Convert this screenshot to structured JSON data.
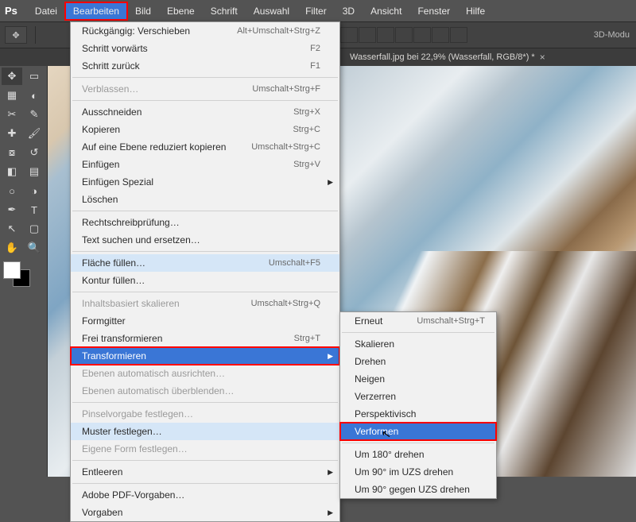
{
  "menubar": {
    "logo": "Ps",
    "items": [
      "Datei",
      "Bearbeiten",
      "Bild",
      "Ebene",
      "Schrift",
      "Auswahl",
      "Filter",
      "3D",
      "Ansicht",
      "Fenster",
      "Hilfe"
    ],
    "active_index": 1
  },
  "optionbar": {
    "mode_label": "3D-Modu"
  },
  "document_tab": {
    "title": "Wasserfall.jpg bei 22,9% (Wasserfall, RGB/8*) *",
    "close": "×"
  },
  "edit_menu": [
    {
      "label": "Rückgängig: Verschieben",
      "shortcut": "Alt+Umschalt+Strg+Z"
    },
    {
      "label": "Schritt vorwärts",
      "shortcut": "F2"
    },
    {
      "label": "Schritt zurück",
      "shortcut": "F1"
    },
    {
      "sep": true
    },
    {
      "label": "Verblassen…",
      "shortcut": "Umschalt+Strg+F",
      "disabled": true
    },
    {
      "sep": true
    },
    {
      "label": "Ausschneiden",
      "shortcut": "Strg+X"
    },
    {
      "label": "Kopieren",
      "shortcut": "Strg+C"
    },
    {
      "label": "Auf eine Ebene reduziert kopieren",
      "shortcut": "Umschalt+Strg+C"
    },
    {
      "label": "Einfügen",
      "shortcut": "Strg+V"
    },
    {
      "label": "Einfügen Spezial",
      "submenu": true
    },
    {
      "label": "Löschen"
    },
    {
      "sep": true
    },
    {
      "label": "Rechtschreibprüfung…"
    },
    {
      "label": "Text suchen und ersetzen…"
    },
    {
      "sep": true
    },
    {
      "label": "Fläche füllen…",
      "shortcut": "Umschalt+F5",
      "hover": true
    },
    {
      "label": "Kontur füllen…"
    },
    {
      "sep": true
    },
    {
      "label": "Inhaltsbasiert skalieren",
      "shortcut": "Umschalt+Strg+Q",
      "disabled": true
    },
    {
      "label": "Formgitter"
    },
    {
      "label": "Frei transformieren",
      "shortcut": "Strg+T"
    },
    {
      "label": "Transformieren",
      "submenu": true,
      "highlight": true
    },
    {
      "label": "Ebenen automatisch ausrichten…",
      "disabled": true
    },
    {
      "label": "Ebenen automatisch überblenden…",
      "disabled": true
    },
    {
      "sep": true
    },
    {
      "label": "Pinselvorgabe festlegen…",
      "disabled": true
    },
    {
      "label": "Muster festlegen…",
      "hover": true
    },
    {
      "label": "Eigene Form festlegen…",
      "disabled": true
    },
    {
      "sep": true
    },
    {
      "label": "Entleeren",
      "submenu": true
    },
    {
      "sep": true
    },
    {
      "label": "Adobe PDF-Vorgaben…"
    },
    {
      "label": "Vorgaben",
      "submenu": true
    }
  ],
  "transform_submenu": [
    {
      "label": "Erneut",
      "shortcut": "Umschalt+Strg+T"
    },
    {
      "sep": true
    },
    {
      "label": "Skalieren"
    },
    {
      "label": "Drehen"
    },
    {
      "label": "Neigen"
    },
    {
      "label": "Verzerren"
    },
    {
      "label": "Perspektivisch"
    },
    {
      "label": "Verformen",
      "highlight": true
    },
    {
      "sep": true
    },
    {
      "label": "Um 180° drehen"
    },
    {
      "label": "Um 90° im UZS drehen"
    },
    {
      "label": "Um 90° gegen UZS drehen"
    }
  ]
}
